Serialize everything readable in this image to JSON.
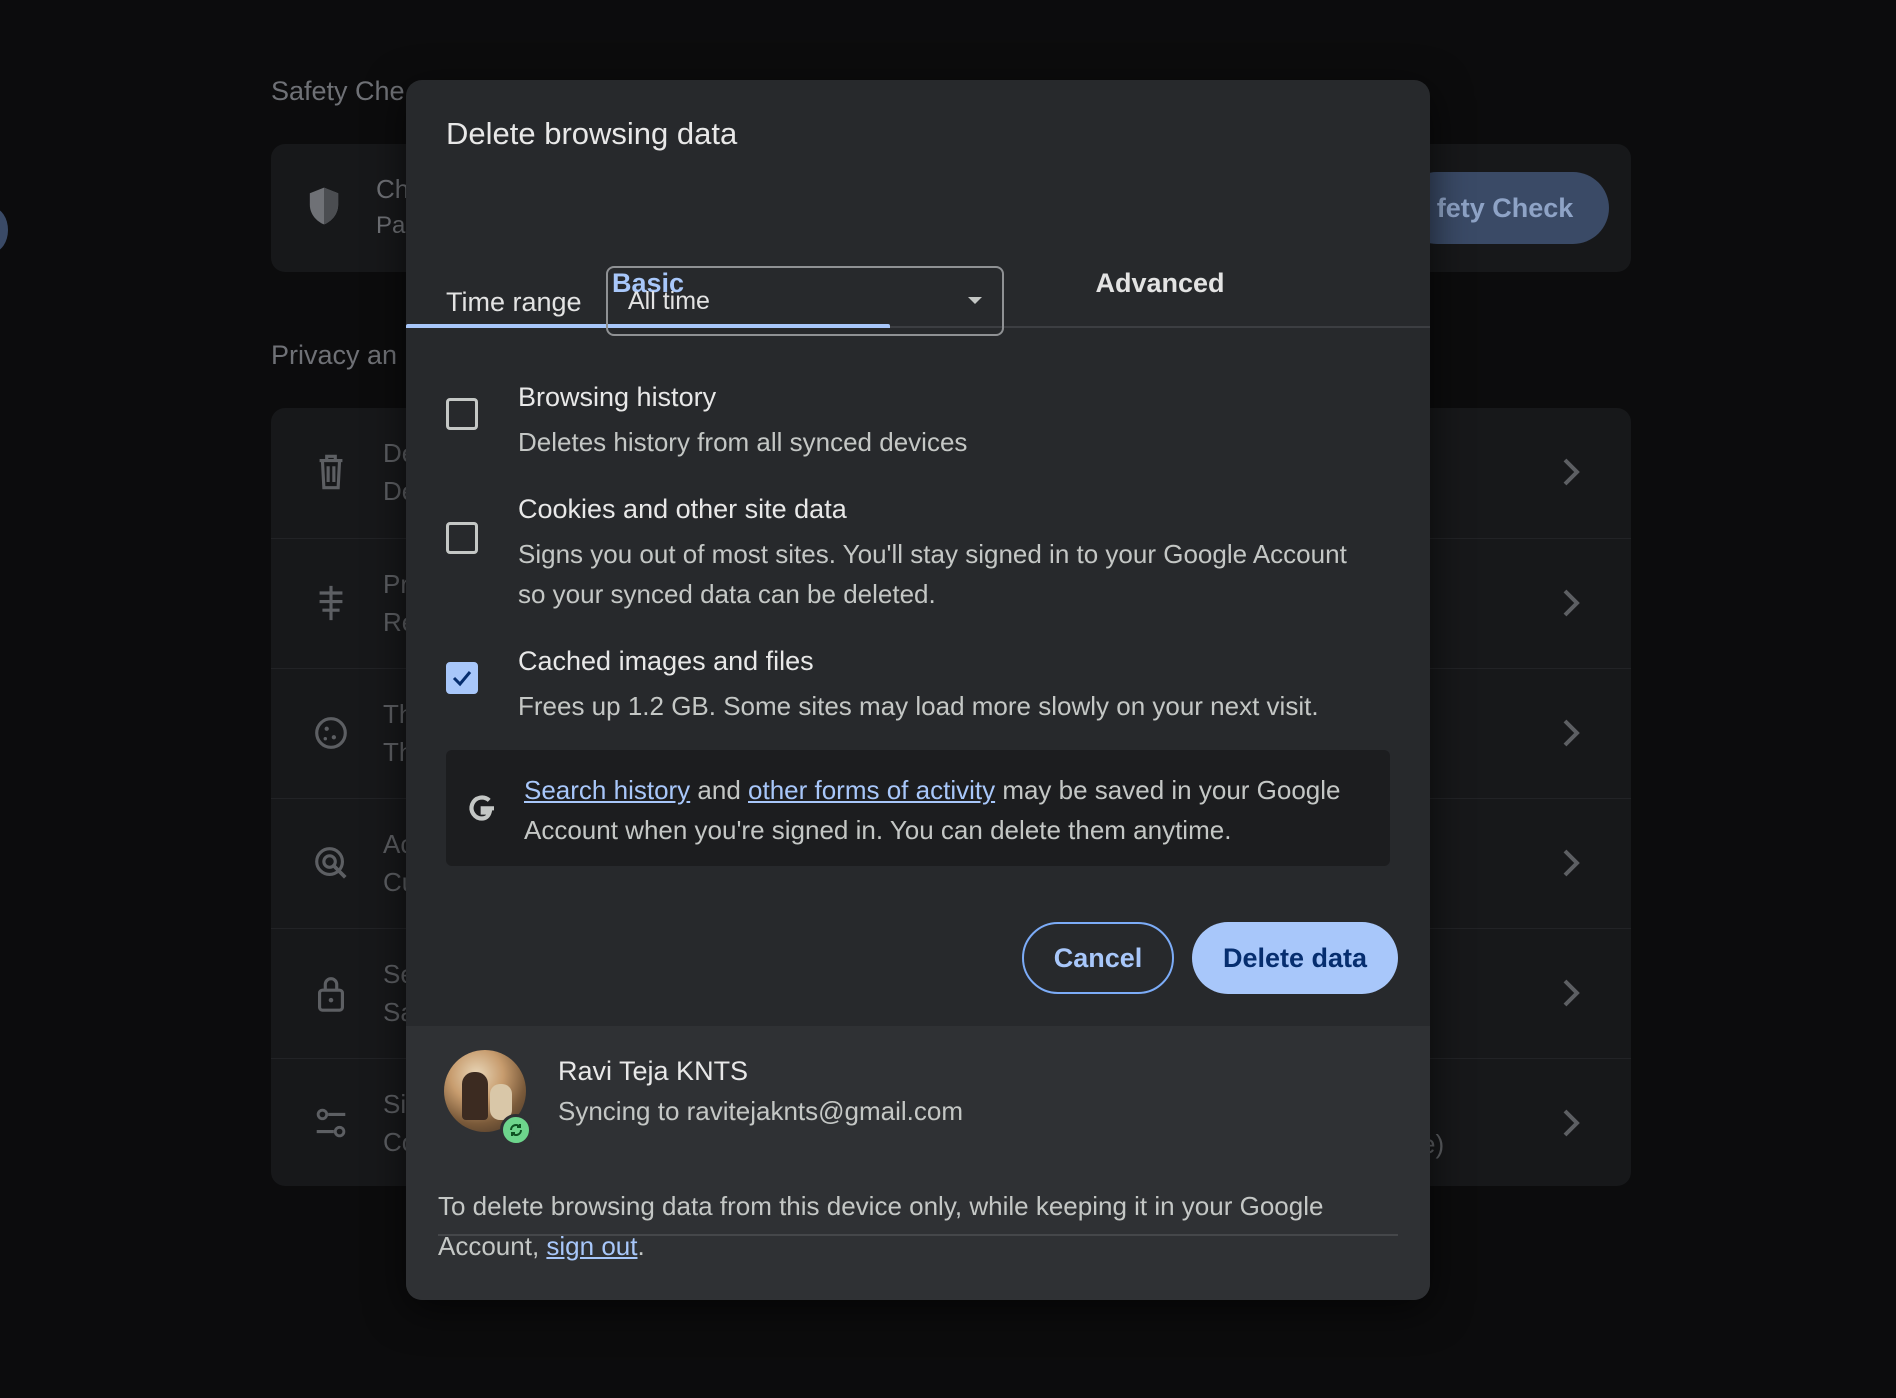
{
  "background": {
    "safety_heading": "Safety Che",
    "safety_card": {
      "line1": "Ch",
      "line2": "Pa",
      "button": "fety Check"
    },
    "privacy_heading": "Privacy an",
    "rows": [
      {
        "icon": "trash-icon",
        "l1": "De",
        "l2": "De"
      },
      {
        "icon": "signpost-icon",
        "l1": "Pr",
        "l2": "Re"
      },
      {
        "icon": "cookie-icon",
        "l1": "Th",
        "l2": "Th"
      },
      {
        "icon": "ads-target-icon",
        "l1": "Ac",
        "l2": "Cu"
      },
      {
        "icon": "lock-icon",
        "l1": "Se",
        "l2": "Sa"
      },
      {
        "icon": "sliders-icon",
        "l1": "Si",
        "l2": "Co",
        "extra": "e)"
      }
    ]
  },
  "dialog": {
    "title": "Delete browsing data",
    "tabs": [
      {
        "label": "Basic",
        "active": true
      },
      {
        "label": "Advanced",
        "active": false
      }
    ],
    "time_range": {
      "label": "Time range",
      "value": "All time"
    },
    "options": [
      {
        "title": "Browsing history",
        "desc": "Deletes history from all synced devices",
        "checked": false
      },
      {
        "title": "Cookies and other site data",
        "desc": "Signs you out of most sites. You'll stay signed in to your Google Account so your synced data can be deleted.",
        "checked": false
      },
      {
        "title": "Cached images and files",
        "desc": "Frees up 1.2 GB. Some sites may load more slowly on your next visit.",
        "checked": true
      }
    ],
    "google_notice": {
      "link1": "Search history",
      "and": " and ",
      "link2": "other forms of activity",
      "rest": " may be saved in your Google Account when you're signed in. You can delete them anytime."
    },
    "buttons": {
      "cancel": "Cancel",
      "delete": "Delete data"
    },
    "account": {
      "name": "Ravi Teja KNTS",
      "sync": "Syncing to ravitejaknts@gmail.com"
    },
    "footer_note": {
      "text": "To delete browsing data from this device only, while keeping it in your Google Account, ",
      "link": "sign out",
      "end": "."
    }
  },
  "colors": {
    "accent": "#a8c7fa",
    "dialog_bg": "#27292c",
    "footer_bg": "#2f3134",
    "sync_green": "#6dd58c"
  }
}
